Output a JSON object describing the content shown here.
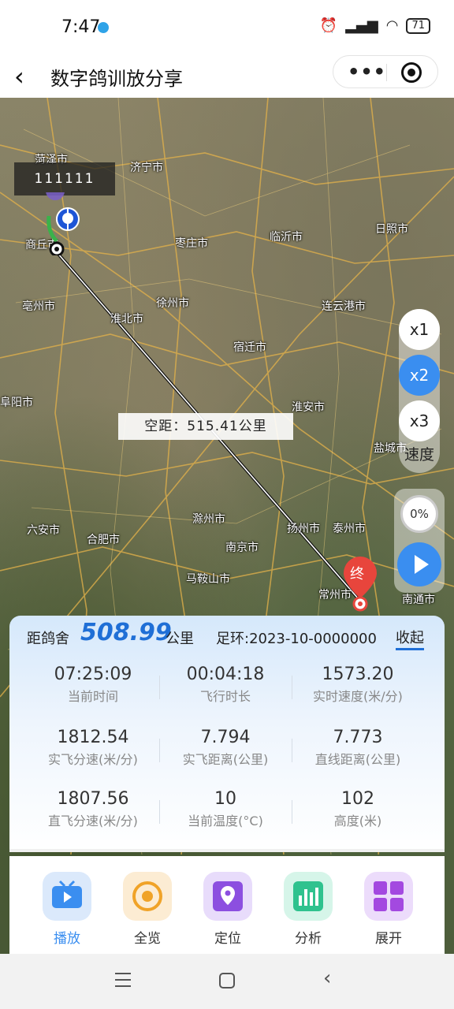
{
  "status_bar": {
    "time": "7:47",
    "battery": "71"
  },
  "nav": {
    "title": "数字鸽训放分享"
  },
  "map": {
    "pigeon_tag": "111111",
    "route_distance_label": "空距：515.41公里",
    "end_marker_label": "终",
    "cities": [
      {
        "name": "菏泽市"
      },
      {
        "name": "济宁市"
      },
      {
        "name": "日照市"
      },
      {
        "name": "枣庄市"
      },
      {
        "name": "临沂市"
      },
      {
        "name": "商丘市"
      },
      {
        "name": "徐州市"
      },
      {
        "name": "连云港市"
      },
      {
        "name": "亳州市"
      },
      {
        "name": "淮北市"
      },
      {
        "name": "宿迁市"
      },
      {
        "name": "阜阳市"
      },
      {
        "name": "淮安市"
      },
      {
        "name": "盐城市"
      },
      {
        "name": "六安市"
      },
      {
        "name": "合肥市"
      },
      {
        "name": "滁州市"
      },
      {
        "name": "扬州市"
      },
      {
        "name": "泰州市"
      },
      {
        "name": "南京市"
      },
      {
        "name": "马鞍山市"
      },
      {
        "name": "常州市"
      },
      {
        "name": "南通市"
      }
    ]
  },
  "speed_controls": {
    "options": [
      "x1",
      "x2",
      "x3"
    ],
    "selected": "x2",
    "label": "速度"
  },
  "playback": {
    "progress_percent": 0,
    "progress_text": "0%"
  },
  "info": {
    "distance_label": "距鸽舍",
    "distance_value": "508.99",
    "distance_unit": "公里",
    "ring": "足环:2023-10-0000000",
    "collapse": "收起",
    "stats": [
      {
        "value": "07:25:09",
        "label": "当前时间"
      },
      {
        "value": "00:04:18",
        "label": "飞行时长"
      },
      {
        "value": "1573.20",
        "label": "实时速度(米/分)"
      },
      {
        "value": "1812.54",
        "label": "实飞分速(米/分)"
      },
      {
        "value": "7.794",
        "label": "实飞距离(公里)"
      },
      {
        "value": "7.773",
        "label": "直线距离(公里)"
      },
      {
        "value": "1807.56",
        "label": "直飞分速(米/分)"
      },
      {
        "value": "10",
        "label": "当前温度(°C)"
      },
      {
        "value": "102",
        "label": "高度(米)"
      }
    ]
  },
  "toolbar": {
    "items": [
      {
        "label": "播放",
        "icon": "tv-play-icon",
        "color": "#3a8ef0",
        "bg": "#dbe9fb"
      },
      {
        "label": "全览",
        "icon": "overview-target-icon",
        "color": "#f0a328",
        "bg": "#fcecd3"
      },
      {
        "label": "定位",
        "icon": "location-pin-icon",
        "color": "#8c4fe0",
        "bg": "#e8dcfb"
      },
      {
        "label": "分析",
        "icon": "bar-chart-icon",
        "color": "#2fc28e",
        "bg": "#d6f5e9"
      },
      {
        "label": "展开",
        "icon": "grid-expand-icon",
        "color": "#a349e0",
        "bg": "#ecdcfb"
      }
    ],
    "active": "播放"
  }
}
